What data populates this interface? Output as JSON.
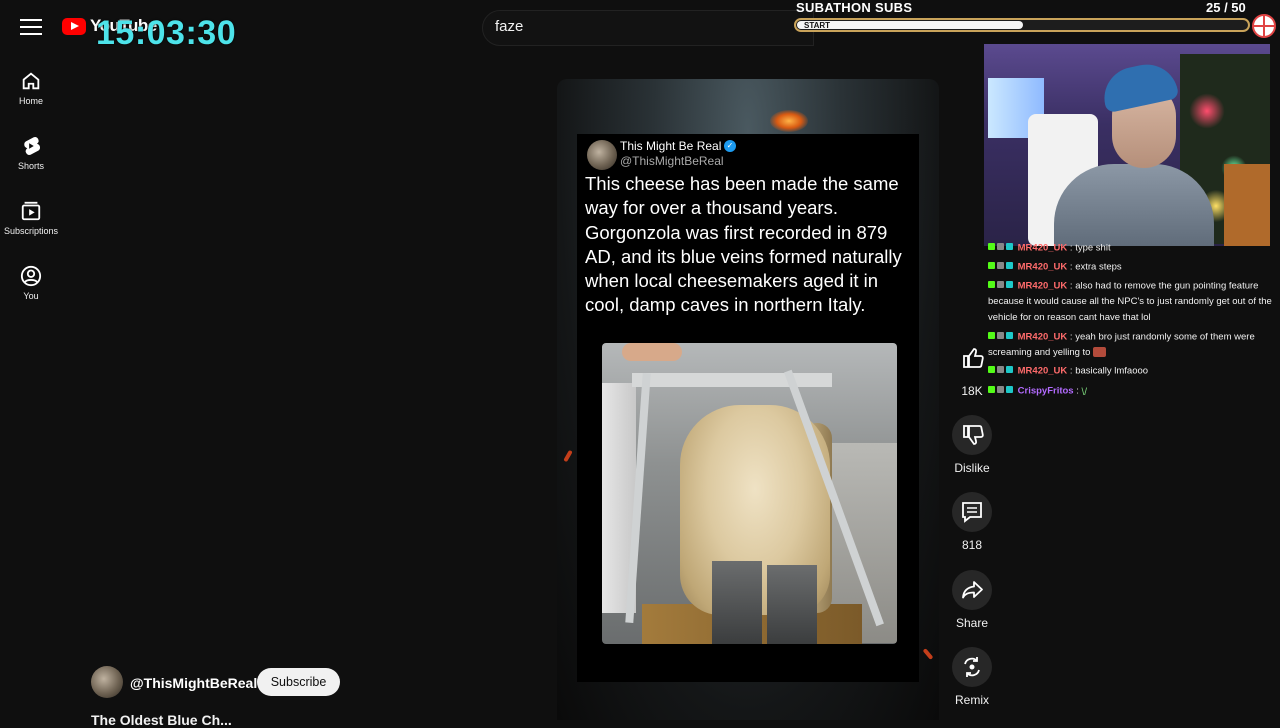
{
  "header": {
    "logo_text": "YouTube",
    "clock": "15:03:30",
    "search_value": "faze"
  },
  "subathon": {
    "title": "SUBATHON SUBS",
    "count": "25  / 50",
    "progress": 0.5,
    "start_label": "START",
    "bar_color": "#c9a35a"
  },
  "sidebar": {
    "items": [
      {
        "label": "Home",
        "icon": "home-icon"
      },
      {
        "label": "Shorts",
        "icon": "shorts-icon"
      },
      {
        "label": "Subscriptions",
        "icon": "subscriptions-icon"
      },
      {
        "label": "You",
        "icon": "user-icon"
      }
    ]
  },
  "video": {
    "tweet_name": "This Might Be Real",
    "tweet_handle": "@ThisMightBeReal",
    "tweet_text": "This cheese has been made the same way for over a thousand years. Gorgonzola was first recorded in 879 AD, and its blue veins formed naturally when local cheesemakers aged it in cool, damp caves in northern Italy.",
    "channel_name": "@ThisMightBeReal",
    "subscribe_label": "Subscribe",
    "title_partial": "The Oldest Blue Ch..."
  },
  "actions": {
    "like_count": "18K",
    "dislike_label": "Dislike",
    "comments_count": "818",
    "share_label": "Share",
    "remix_label": "Remix"
  },
  "chat": {
    "messages": [
      {
        "user": "MR420_UK",
        "text": ": type shit",
        "color": "#ff6b6b"
      },
      {
        "user": "MR420_UK",
        "text": ": extra steps",
        "color": "#ff6b6b"
      },
      {
        "user": "MR420_UK",
        "text": ": also had to remove the gun pointing feature because it would cause all the NPC's to just randomly get out of the vehicle for on reason cant have that lol",
        "color": "#ff6b6b"
      },
      {
        "user": "MR420_UK",
        "text": ": yeah bro just randomly some of them were screaming and yelling to",
        "color": "#ff6b6b"
      },
      {
        "user": "MR420_UK",
        "text": ": basically lmfaooo",
        "color": "#ff6b6b"
      },
      {
        "user": "CrispyFritos",
        "text": ":",
        "color": "#b36bff"
      }
    ]
  }
}
